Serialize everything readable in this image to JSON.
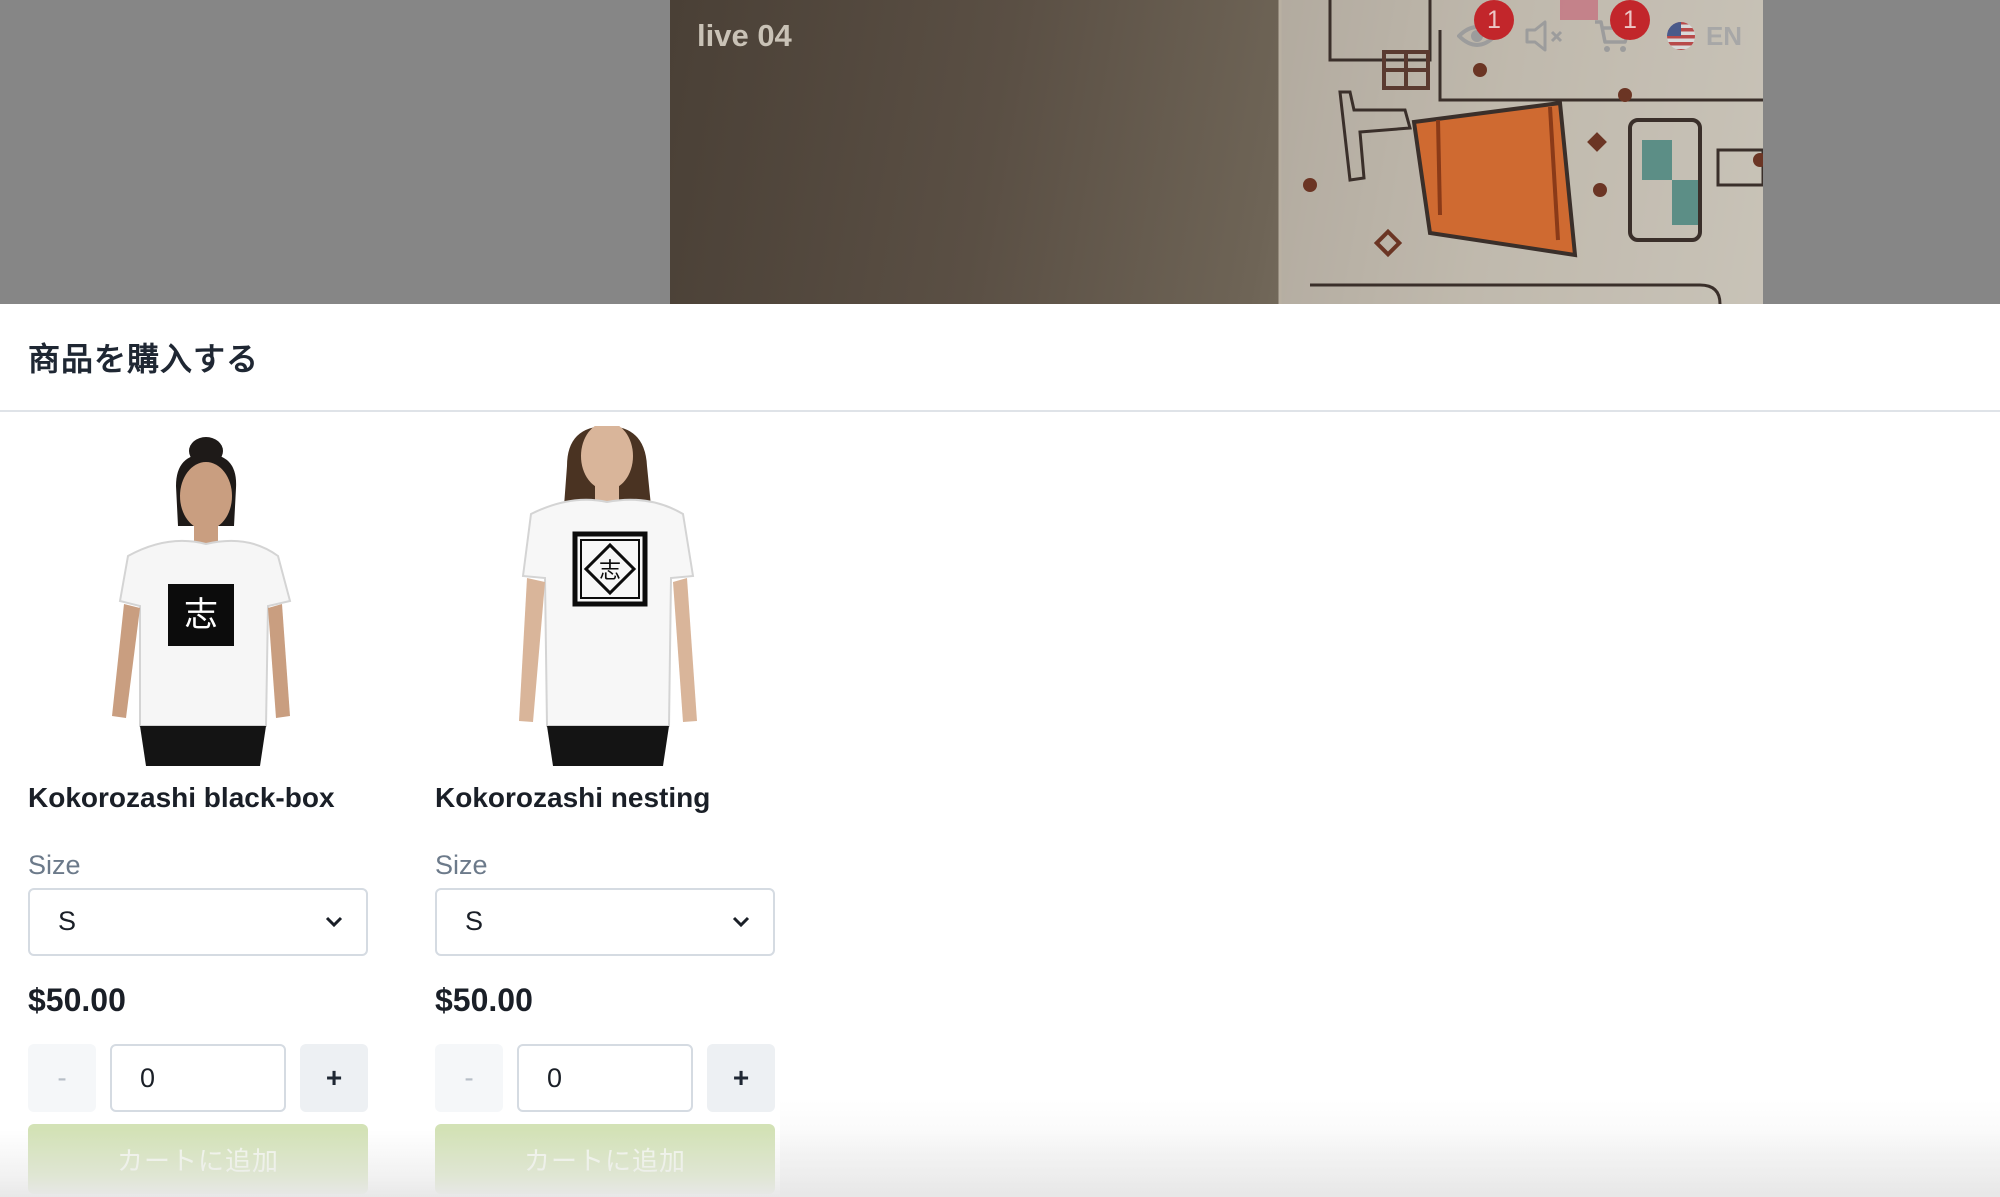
{
  "video": {
    "title": "live 04",
    "viewer_count": "1",
    "cart_count": "1",
    "language": "EN",
    "icons": [
      "eye-icon",
      "muted-speaker-icon",
      "cart-icon",
      "us-flag-icon"
    ]
  },
  "panel": {
    "title": "商品を購入する"
  },
  "products": [
    {
      "name": "Kokorozashi black-box",
      "size_label": "Size",
      "size_value": "S",
      "price": "$50.00",
      "minus_label": "-",
      "plus_label": "+",
      "quantity": "0",
      "add_to_cart_label": "カートに追加",
      "image_glyph": "志"
    },
    {
      "name": "Kokorozashi nesting",
      "size_label": "Size",
      "size_value": "S",
      "price": "$50.00",
      "minus_label": "-",
      "plus_label": "+",
      "quantity": "0",
      "add_to_cart_label": "カートに追加",
      "image_glyph": "志"
    }
  ],
  "colors": {
    "add_to_cart_disabled": "#d3e2b6",
    "badge": "#c2262b",
    "title_text": "#1f2733"
  }
}
